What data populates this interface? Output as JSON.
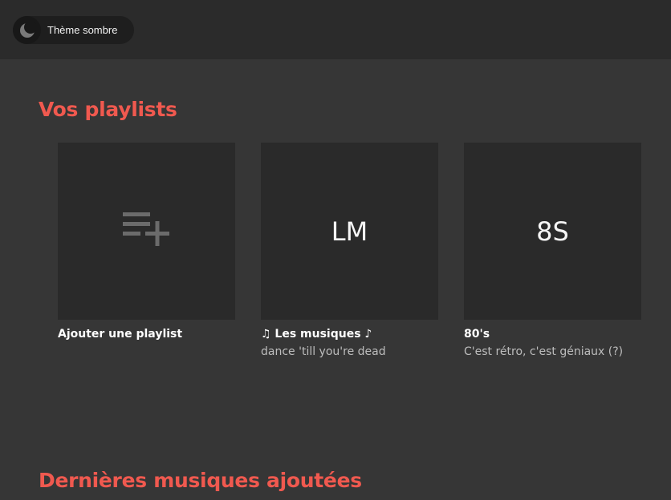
{
  "header": {
    "theme_toggle_label": "Thème sombre",
    "theme_icon": "moon-icon"
  },
  "sections": {
    "playlists_title": "Vos playlists",
    "recent_title": "Dernières musiques ajoutées"
  },
  "playlists": [
    {
      "initials": "",
      "icon": "playlist-add-icon",
      "name": "Ajouter une playlist",
      "description": ""
    },
    {
      "initials": "LM",
      "name": "♫ Les musiques ♪",
      "description": "dance 'till you're dead"
    },
    {
      "initials": "8S",
      "name": "80's",
      "description": "C'est rétro, c'est géniaux (?)"
    }
  ],
  "colors": {
    "accent": "#f0594f",
    "background": "#363636",
    "header": "#2b2b2b",
    "card": "#2a2a2a"
  }
}
